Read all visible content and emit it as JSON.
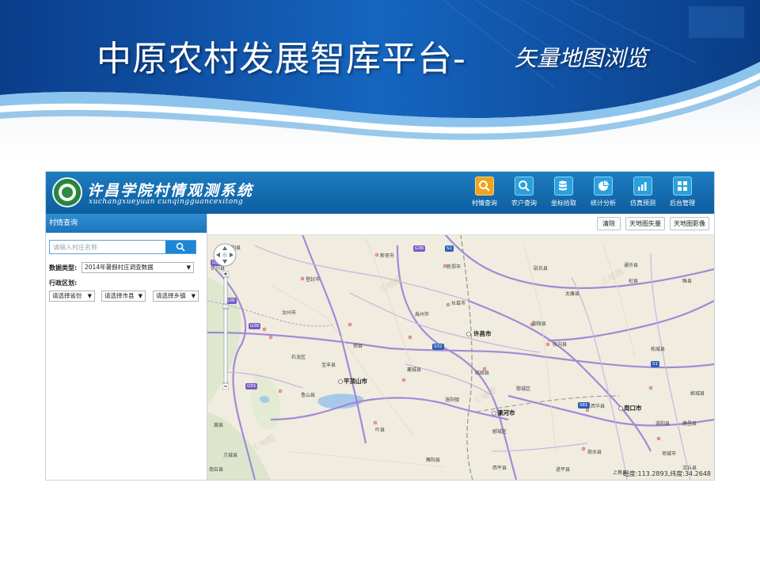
{
  "slide": {
    "title": "中原农村发展智库平台-",
    "subtitle": "矢量地图浏览"
  },
  "app": {
    "name": "许昌学院村情观测系统",
    "subname": "xuchangxueyuan cunqingguancexitong",
    "nav": [
      {
        "label": "村情查询",
        "icon": "search-icon",
        "active": true
      },
      {
        "label": "农户查询",
        "icon": "search-icon",
        "active": false
      },
      {
        "label": "坐标拾取",
        "icon": "database-icon",
        "active": false
      },
      {
        "label": "统计分析",
        "icon": "pie-chart-icon",
        "active": false
      },
      {
        "label": "仿真预测",
        "icon": "bar-chart-icon",
        "active": false
      },
      {
        "label": "后台管理",
        "icon": "grid-icon",
        "active": false
      }
    ],
    "accent_color": "#1c87d4",
    "active_nav_color": "#f2a31b"
  },
  "sidebar": {
    "heading": "村情查询",
    "search_placeholder": "请输入村庄名称",
    "data_type_label": "数据类型:",
    "data_type_value": "2014年暑假村庄调查数据",
    "region_label": "行政区划:",
    "province": "请选择省份",
    "city": "请选择市县",
    "town": "请选择乡镇"
  },
  "map": {
    "toolbar": {
      "clear": "清除",
      "vector": "天地图矢量",
      "imagery": "天地图影像"
    },
    "coords": "经度:113.2893,纬度:34.2648",
    "cities": [
      {
        "name": "许昌市"
      },
      {
        "name": "平顶山市"
      },
      {
        "name": "漯河市"
      },
      {
        "name": "周口市"
      }
    ],
    "places": [
      "郏县",
      "宝丰县",
      "鲁山县",
      "叶县",
      "襄城县",
      "禹州市",
      "长葛市",
      "鄢陵县",
      "扶沟县",
      "西华县",
      "商水县",
      "临颍县",
      "汝州市",
      "新密市",
      "新郑市",
      "尉氏县",
      "太康县",
      "登封市",
      "舞阳县",
      "西平县",
      "项城市",
      "淮阳县",
      "郾城区",
      "遂平县",
      "洛阳镇",
      "方城县",
      "鄢城区",
      "石龙区",
      "汝阳县",
      "伊川县",
      "嵩县",
      "南召县",
      "通许县",
      "杞县",
      "睢县",
      "柘城县",
      "鹿邑县",
      "沈丘县",
      "上蔡县",
      "郸城县"
    ],
    "highways": [
      "G30",
      "G36",
      "G55",
      "S32",
      "S81",
      "S1",
      "S1",
      "S38",
      "G36"
    ]
  }
}
